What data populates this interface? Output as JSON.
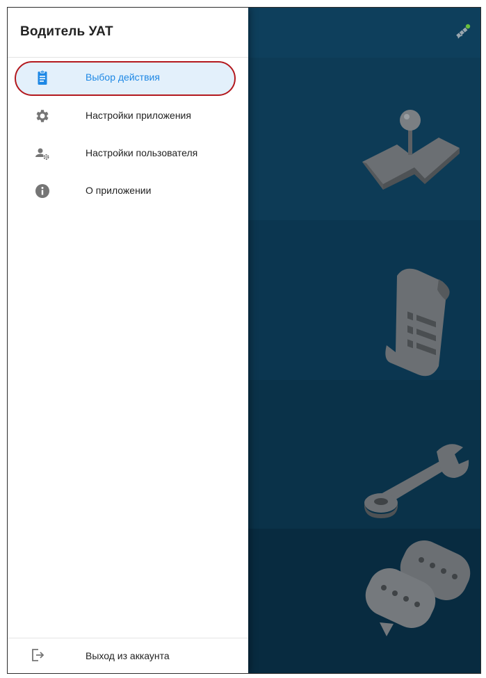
{
  "colors": {
    "accent": "#1e88e5",
    "highlight_ring": "#b3181d",
    "highlight_fill": "#e3f0fb",
    "icon_gray": "#757575",
    "app_background": "#0c3c58",
    "gps_dot": "#6abf3b"
  },
  "drawer": {
    "title": "Водитель УАТ",
    "items": [
      {
        "label": "Выбор действия",
        "icon": "clipboard-icon",
        "active": true
      },
      {
        "label": "Настройки приложения",
        "icon": "gear-icon",
        "active": false
      },
      {
        "label": "Настройки пользователя",
        "icon": "user-settings-icon",
        "active": false
      },
      {
        "label": "О приложении",
        "icon": "info-icon",
        "active": false
      }
    ],
    "footer": {
      "label": "Выход из аккаунта",
      "icon": "logout-icon"
    }
  },
  "background_app": {
    "toolbar_icon": "gps-satellite-icon",
    "tiles": [
      {
        "icon": "gearshift-map-icon"
      },
      {
        "icon": "receipt-scroll-icon"
      },
      {
        "icon": "wrench-icon"
      },
      {
        "icon": "chat-bubbles-icon"
      }
    ]
  }
}
